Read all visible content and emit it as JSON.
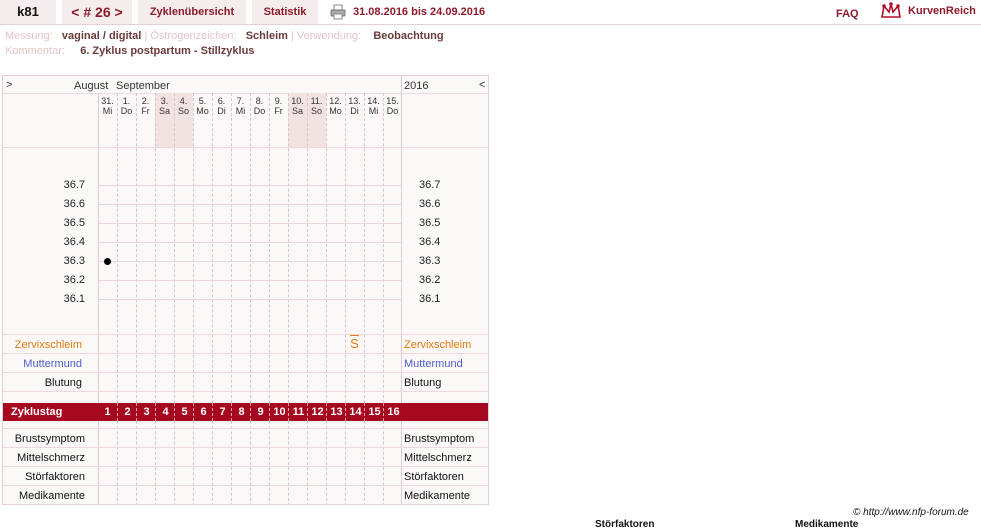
{
  "header": {
    "user": "k81",
    "cycle_nav": "< # 26 >",
    "tab_overview": "Zyklenübersicht",
    "tab_stats": "Statistik",
    "date_range": "31.08.2016 bis 24.09.2016",
    "faq": "FAQ",
    "logo_text": "KurvenReich"
  },
  "meta": {
    "messung_label": "Messung:",
    "messung_value": "vaginal / digital",
    "oestrogen_label": "Östrogenzeichen:",
    "oestrogen_value": "Schleim",
    "verwendung_label": "Verwendung:",
    "verwendung_value": "Beobachtung",
    "kommentar_label": "Kommentar:",
    "kommentar_value": "6. Zyklus postpartum - Stillzyklus"
  },
  "chart": {
    "nav_left": ">",
    "nav_right": "<",
    "month_aug": "August",
    "month_sep": "September",
    "year": "2016",
    "days": [
      {
        "d": "31.",
        "w": "Mi",
        "weekend": false
      },
      {
        "d": "1.",
        "w": "Do",
        "weekend": false
      },
      {
        "d": "2.",
        "w": "Fr",
        "weekend": false
      },
      {
        "d": "3.",
        "w": "Sa",
        "weekend": true
      },
      {
        "d": "4.",
        "w": "So",
        "weekend": true
      },
      {
        "d": "5.",
        "w": "Mo",
        "weekend": false
      },
      {
        "d": "6.",
        "w": "Di",
        "weekend": false
      },
      {
        "d": "7.",
        "w": "Mi",
        "weekend": false
      },
      {
        "d": "8.",
        "w": "Do",
        "weekend": false
      },
      {
        "d": "9.",
        "w": "Fr",
        "weekend": false
      },
      {
        "d": "10.",
        "w": "Sa",
        "weekend": true
      },
      {
        "d": "11.",
        "w": "So",
        "weekend": true
      },
      {
        "d": "12.",
        "w": "Mo",
        "weekend": false
      },
      {
        "d": "13.",
        "w": "Di",
        "weekend": false
      },
      {
        "d": "14.",
        "w": "Mi",
        "weekend": false
      },
      {
        "d": "15.",
        "w": "Do",
        "weekend": false
      }
    ],
    "temp_ticks": [
      "36.7",
      "36.6",
      "36.5",
      "36.4",
      "36.3",
      "36.2",
      "36.1"
    ],
    "temp_points": [
      {
        "day_index": 0,
        "value": 36.3
      }
    ],
    "mucus_marks": [
      {
        "day_index": 13,
        "symbol": "S"
      }
    ],
    "row_zervix": "Zervixschleim",
    "row_muttermund": "Muttermund",
    "row_blutung": "Blutung",
    "zyklustag_label": "Zyklustag",
    "zyklustage": [
      "1",
      "2",
      "3",
      "4",
      "5",
      "6",
      "7",
      "8",
      "9",
      "10",
      "11",
      "12",
      "13",
      "14",
      "15",
      "16"
    ],
    "row_brust": "Brustsymptom",
    "row_mittel": "Mittelschmerz",
    "row_stoer": "Störfaktoren",
    "row_medi": "Medikamente"
  },
  "footer": {
    "copyright": "© http://www.nfp-forum.de",
    "cut_label_1": "Störfaktoren",
    "cut_label_2": "Medikamente"
  },
  "colors": {
    "accent": "#8b1a2b",
    "zyklus_bar": "#a6091f",
    "zervix": "#e07a10",
    "muttermund": "#4a5fc8"
  }
}
